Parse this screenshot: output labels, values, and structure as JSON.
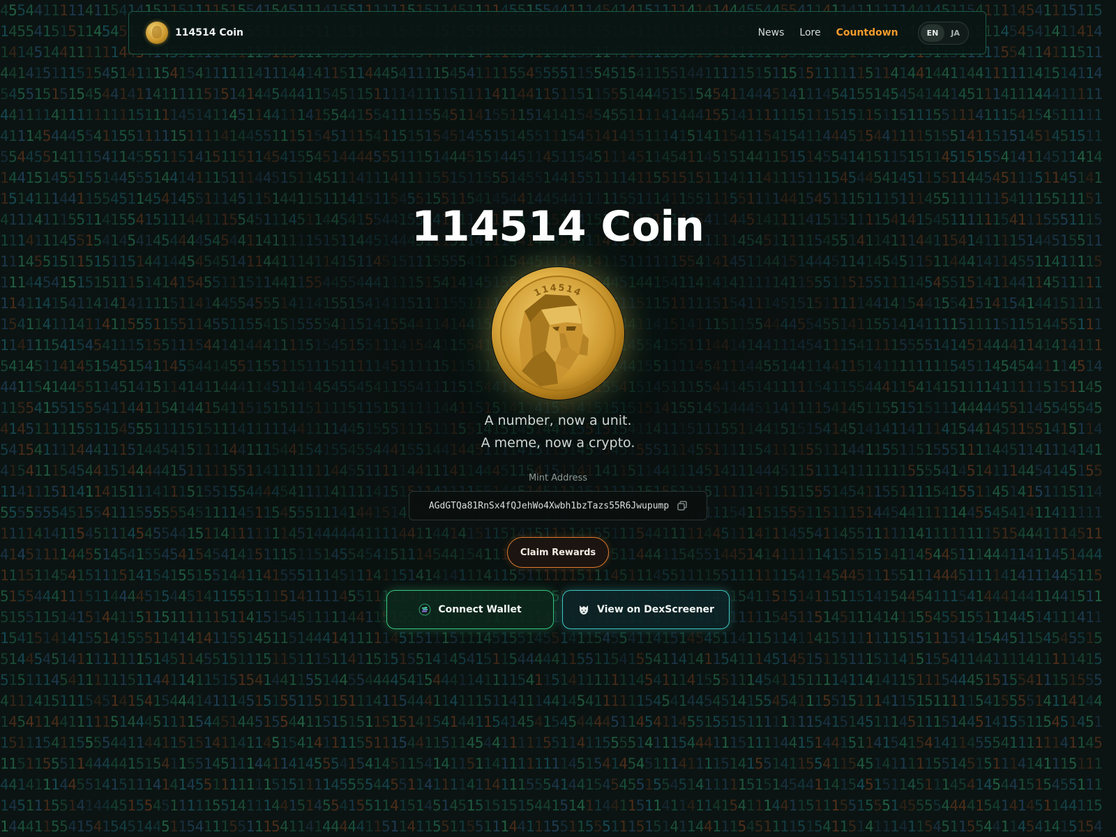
{
  "nav": {
    "brand_name": "114514 Coin",
    "links": [
      {
        "label": "News",
        "active": false
      },
      {
        "label": "Lore",
        "active": false
      },
      {
        "label": "Countdown",
        "active": true
      }
    ],
    "languages": [
      {
        "label": "EN",
        "selected": true
      },
      {
        "label": "JA",
        "selected": false
      }
    ]
  },
  "hero": {
    "title": "114514 Coin",
    "tagline_1": "A number, now a unit.",
    "tagline_2": "A meme, now a crypto.",
    "coin_engraving": "114514"
  },
  "mint": {
    "label": "Mint Address",
    "address": "AGdGTQa81RnSx4fQJehWo4Xwbh1bzTazs55R6Jwupump"
  },
  "buttons": {
    "claim_label": "Claim Rewards",
    "connect_label": "Connect Wallet",
    "dex_label": "View on DexScreener"
  },
  "icons": {
    "brand": "coin-logo-icon",
    "copy": "copy-icon",
    "wallet": "solana-icon",
    "dex": "dexscreener-icon"
  },
  "colors": {
    "background": "#0b1412",
    "accent_orange": "#f39a2b",
    "claim_border": "#e07b2c",
    "connect_border": "#37c77e",
    "dex_border": "#3ec6c4",
    "nav_border": "#1d5a45",
    "matrix_palette": [
      "#1f6a4e",
      "#1b5d6a",
      "#6a3a1f",
      "#2a7a55",
      "#264a6a"
    ]
  }
}
